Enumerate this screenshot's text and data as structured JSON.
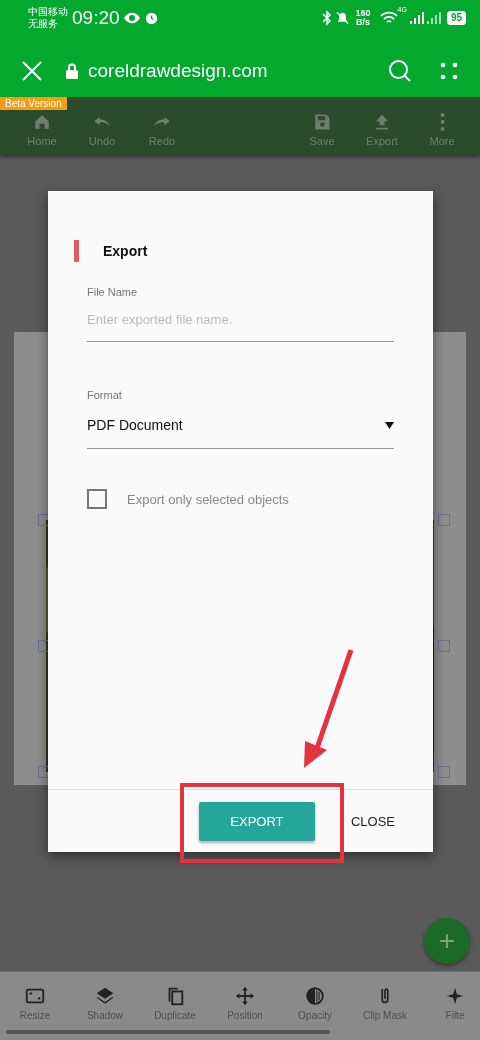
{
  "status_bar": {
    "carrier": "中国移动",
    "service": "无服务",
    "time": "09:20",
    "speed": "160",
    "speed_unit": "B/s",
    "network": "4G",
    "battery": "95"
  },
  "browser_bar": {
    "url": "coreldrawdesign.com"
  },
  "app_toolbar": {
    "badge": "Beta Version",
    "items": [
      {
        "label": "Home"
      },
      {
        "label": "Undo"
      },
      {
        "label": "Redo"
      },
      {
        "label": "Save"
      },
      {
        "label": "Export"
      },
      {
        "label": "More"
      }
    ]
  },
  "dialog": {
    "title": "Export",
    "file_name": {
      "label": "File Name",
      "placeholder": "Enter exported file name."
    },
    "format": {
      "label": "Format",
      "value": "PDF Document"
    },
    "option": {
      "label": "Export only selected objects",
      "checked": false
    },
    "buttons": [
      {
        "label": "EXPORT",
        "kind": "primary"
      },
      {
        "label": "CLOSE",
        "kind": "text"
      }
    ]
  },
  "fab": {
    "label": "+"
  },
  "bottom_toolbar": {
    "items": [
      {
        "label": "Resize"
      },
      {
        "label": "Shadow"
      },
      {
        "label": "Duplicate"
      },
      {
        "label": "Position"
      },
      {
        "label": "Opacity"
      },
      {
        "label": "Clip Mask"
      },
      {
        "label": "Filte"
      }
    ]
  }
}
